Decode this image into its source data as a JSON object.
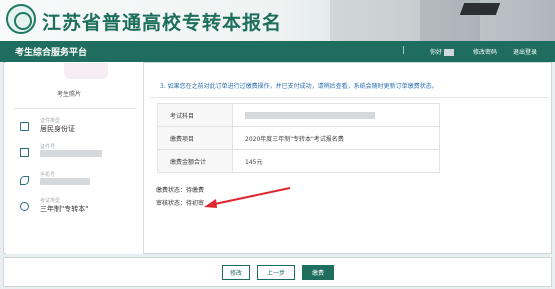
{
  "banner": {
    "title": "江苏省普通高校专转本报名"
  },
  "header": {
    "platform": "考生综合服务平台",
    "divider": "|",
    "greeting": "你好",
    "change_password": "修改密码",
    "logout": "退出登录"
  },
  "sidebar": {
    "photo_label": "考生照片",
    "items": [
      {
        "key": "证件类型",
        "value": "居民身份证",
        "icon": "id-card-icon"
      },
      {
        "key": "证件号",
        "value": "",
        "icon": "clipboard-icon"
      },
      {
        "key": "手机号",
        "value": "",
        "icon": "phone-icon"
      },
      {
        "key": "考试类型",
        "value": "三年制\"专转本\"",
        "icon": "graduate-icon"
      }
    ]
  },
  "main": {
    "notice": "3. 如果您在之前对此订单进行过缴费操作，并已支付成功，请稍后查看，系统会随时更新订单缴费状态。",
    "rows": [
      {
        "key": "考试科目",
        "value": ""
      },
      {
        "key": "缴费项目",
        "value": "2020年度三年制\"专转本\"考试报名费"
      },
      {
        "key": "缴费金额合计",
        "value": "145元"
      }
    ],
    "pay_status": "缴费状态：待缴费",
    "review_status": "审核状态：待初审"
  },
  "footer": {
    "edit": "修改",
    "prev": "上一步",
    "pay": "缴费"
  },
  "colors": {
    "brand": "#1f6d5e",
    "notice": "#2a6fb0",
    "annotation": "#e0262e"
  }
}
